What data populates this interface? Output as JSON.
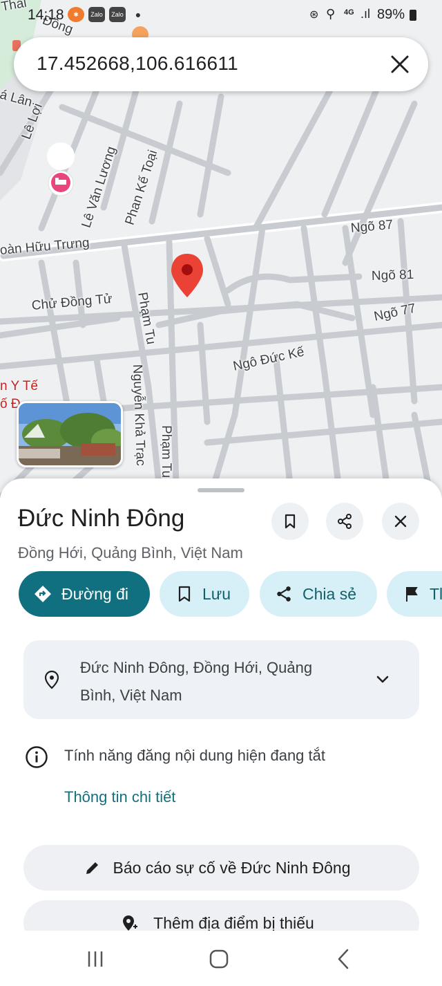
{
  "status_bar": {
    "time": "14:18",
    "notification_icons": [
      "xiaomi-icon",
      "zalo-icon",
      "zalo-icon",
      "dot-icon"
    ],
    "battery": "89%",
    "network": "4G"
  },
  "search": {
    "query": "17.452668,106.616611"
  },
  "map": {
    "street_labels": {
      "le_loi": "Lê Lợi",
      "a_lan": "á Lân",
      "le_van_luong": "Lê Văn Lương",
      "phan_ke_toai": "Phan Kế Toại",
      "doan_huu_trung": "oàn Hữu Trưng",
      "ngo87": "Ngõ 87",
      "ngo81": "Ngõ 81",
      "ngo77": "Ngõ 77",
      "chu_dong_tu": "Chử Đồng Tử",
      "pham_tu_1": "Phạm Tu",
      "pham_tu_2": "Phạm Tu",
      "ngo_duc_ke": "Ngô Đức Kế",
      "nguyen_khac": "Nguyễn Khả Trạc",
      "thai": "Thái",
      "dong": "Đồng"
    },
    "poi_red_1": "n Y Tế",
    "poi_red_2": "ố Đ"
  },
  "place": {
    "title": "Đức Ninh Đông",
    "subtitle": "Đồng Hới, Quảng Bình, Việt Nam",
    "address": "Đức Ninh Đông, Đồng Hới, Quảng Bình, Việt Nam"
  },
  "chips": {
    "directions": "Đường đi",
    "save": "Lưu",
    "share": "Chia sẻ",
    "report": "Tl"
  },
  "info": {
    "notice": "Tính năng đăng nội dung hiện đang tắt",
    "details_link": "Thông tin chi tiết"
  },
  "actions": {
    "report_issue": "Báo cáo sự cố về Đức Ninh Đông",
    "add_missing": "Thêm địa điểm bị thiếu"
  },
  "colors": {
    "primary": "#10707f",
    "chip_bg": "#d7f0f8",
    "pin": "#ea4335"
  }
}
